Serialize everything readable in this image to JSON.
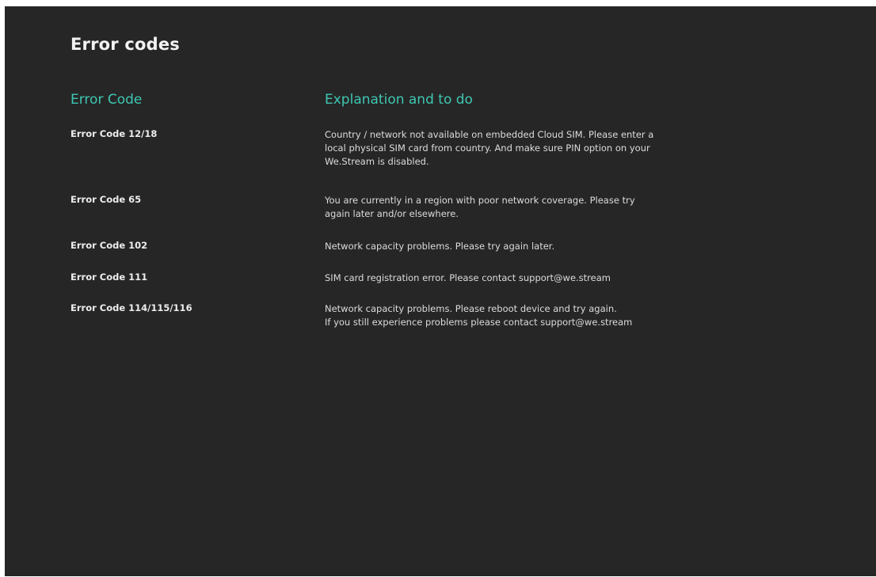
{
  "page": {
    "title": "Error codes"
  },
  "table": {
    "headers": {
      "code": "Error Code",
      "explanation": "Explanation and to do"
    },
    "rows": [
      {
        "code": "Error Code 12/18",
        "explanation_lines": [
          "Country / network not available on embedded Cloud SIM. Please enter a",
          "local physical SIM card from country. And make sure PIN option on your",
          "We.Stream is disabled."
        ]
      },
      {
        "code": "Error Code 65",
        "explanation_lines": [
          "You are currently in a region with poor network coverage. Please try",
          "again later and/or elsewhere."
        ]
      },
      {
        "code": "Error Code 102",
        "explanation_lines": [
          "Network capacity problems. Please try again later."
        ]
      },
      {
        "code": "Error Code 111",
        "explanation_lines": [
          "SIM card registration error. Please contact support@we.stream"
        ]
      },
      {
        "code": "Error Code 114/115/116",
        "explanation_lines": [
          "Network capacity problems. Please reboot device and try again.",
          "If you still experience problems please contact support@we.stream"
        ]
      }
    ]
  },
  "colors": {
    "background": "#262626",
    "accent": "#3ec7b2",
    "text": "#e8e8e8"
  }
}
